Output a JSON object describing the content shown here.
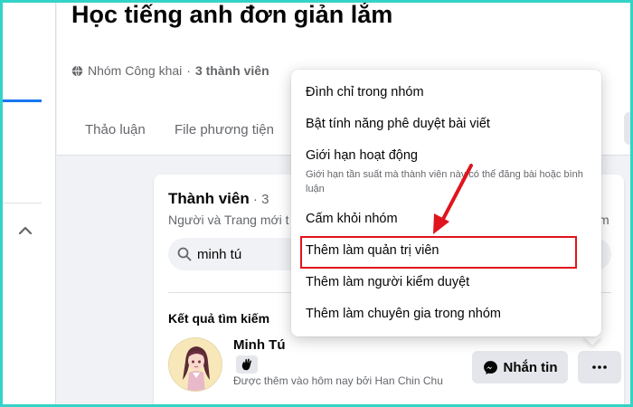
{
  "header": {
    "group_title": "Học tiếng anh đơn giản lắm",
    "privacy": "Nhóm Công khai",
    "separator": " · ",
    "member_count": "3 thành viên",
    "tabs": [
      {
        "label": "Thảo luận"
      },
      {
        "label": "File phương tiện"
      }
    ]
  },
  "members": {
    "title": "Thành viên",
    "count": " · 3",
    "subtitle": "Người và Trang mới t",
    "subtitle_right": "m",
    "search_value": "minh tú",
    "results_label": "Kết quả tìm kiếm",
    "member": {
      "name": "Minh Tú",
      "description": "Được thêm vào hôm nay bởi Han Chin Chu"
    },
    "message_button": "Nhắn tin"
  },
  "menu": {
    "items": [
      {
        "label": "Đình chỉ trong nhóm"
      },
      {
        "label": "Bật tính năng phê duyệt bài viết"
      },
      {
        "label": "Giới hạn hoạt động",
        "description": "Giới hạn tần suất mà thành viên này có thể đăng bài hoặc bình luận"
      },
      {
        "label": "Cấm khỏi nhóm"
      },
      {
        "label": "Thêm làm quản trị viên"
      },
      {
        "label": "Thêm làm người kiểm duyệt"
      },
      {
        "label": "Thêm làm chuyên gia trong nhóm"
      }
    ],
    "highlighted_index": 4
  },
  "colors": {
    "accent": "#1877f2",
    "highlight": "#e0141c",
    "frame": "#34d3c8"
  }
}
